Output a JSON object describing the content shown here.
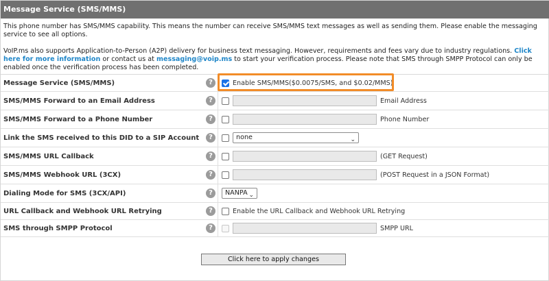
{
  "header": {
    "title": "Message Service (SMS/MMS)"
  },
  "intro": {
    "paragraph1": "This phone number has SMS/MMS capability. This means the number can receive SMS/MMS text messages as well as sending them. Please enable the messaging service to see all options.",
    "paragraph2_part1": "VoIP.ms also supports Application-to-Person (A2P) delivery for business text messaging. However, requirements and fees vary due to industry regulations. ",
    "paragraph2_link1": "Click here for more information",
    "paragraph2_part2": " or contact us at ",
    "paragraph2_link2": "messaging@voip.ms",
    "paragraph2_part3": " to start your verification process. Please note that SMS through SMPP Protocol can only be enabled once the verification process has been completed."
  },
  "rows": [
    {
      "label": "Message Service (SMS/MMS)",
      "checkbox": true,
      "text": "Enable SMS/MMS($0.0075/SMS, and $0.02/MMS)"
    },
    {
      "label": "SMS/MMS Forward to an Email Address",
      "checkbox": false,
      "input_value": "",
      "after": "Email Address"
    },
    {
      "label": "SMS/MMS Forward to a Phone Number",
      "checkbox": false,
      "input_value": "",
      "after": "Phone Number"
    },
    {
      "label": "Link the SMS received to this DID to a SIP Account",
      "checkbox": false,
      "select_value": "none"
    },
    {
      "label": "SMS/MMS URL Callback",
      "checkbox": false,
      "input_value": "",
      "after": "(GET Request)"
    },
    {
      "label": "SMS/MMS Webhook URL (3CX)",
      "checkbox": false,
      "input_value": "",
      "after": "(POST Request in a JSON Format)"
    },
    {
      "label": "Dialing Mode for SMS (3CX/API)",
      "select_value": "NANPA"
    },
    {
      "label": "URL Callback and Webhook URL Retrying",
      "checkbox": false,
      "text": "Enable the URL Callback and Webhook URL Retrying"
    },
    {
      "label": "SMS through SMPP Protocol",
      "checkbox": false,
      "disabled": true,
      "input_value": "",
      "after": "SMPP URL"
    }
  ],
  "help_glyph": "?",
  "select_arrow": "⌄",
  "apply_button": "Click here to apply changes",
  "colors": {
    "header": "#707070",
    "link": "#1f86c8",
    "highlight": "#f28c28",
    "checkbox": "#1a73e8"
  }
}
